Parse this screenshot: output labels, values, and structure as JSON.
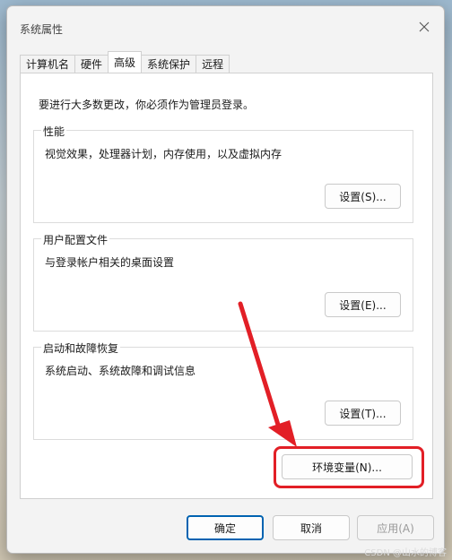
{
  "window": {
    "title": "系统属性",
    "close_icon": "close-icon"
  },
  "tabs": [
    {
      "label": "计算机名",
      "active": false
    },
    {
      "label": "硬件",
      "active": false
    },
    {
      "label": "高级",
      "active": true
    },
    {
      "label": "系统保护",
      "active": false
    },
    {
      "label": "远程",
      "active": false
    }
  ],
  "advanced": {
    "admin_note": "要进行大多数更改，你必须作为管理员登录。",
    "performance": {
      "legend": "性能",
      "description": "视觉效果，处理器计划，内存使用，以及虚拟内存",
      "button": "设置(S)..."
    },
    "user_profiles": {
      "legend": "用户配置文件",
      "description": "与登录帐户相关的桌面设置",
      "button": "设置(E)..."
    },
    "startup_recovery": {
      "legend": "启动和故障恢复",
      "description": "系统启动、系统故障和调试信息",
      "button": "设置(T)..."
    },
    "env_button": "环境变量(N)..."
  },
  "footer": {
    "ok": "确定",
    "cancel": "取消",
    "apply": "应用(A)"
  },
  "watermark": "CSDN @山水的博客",
  "colors": {
    "highlight": "#e21f26",
    "focus": "#0063b1"
  }
}
